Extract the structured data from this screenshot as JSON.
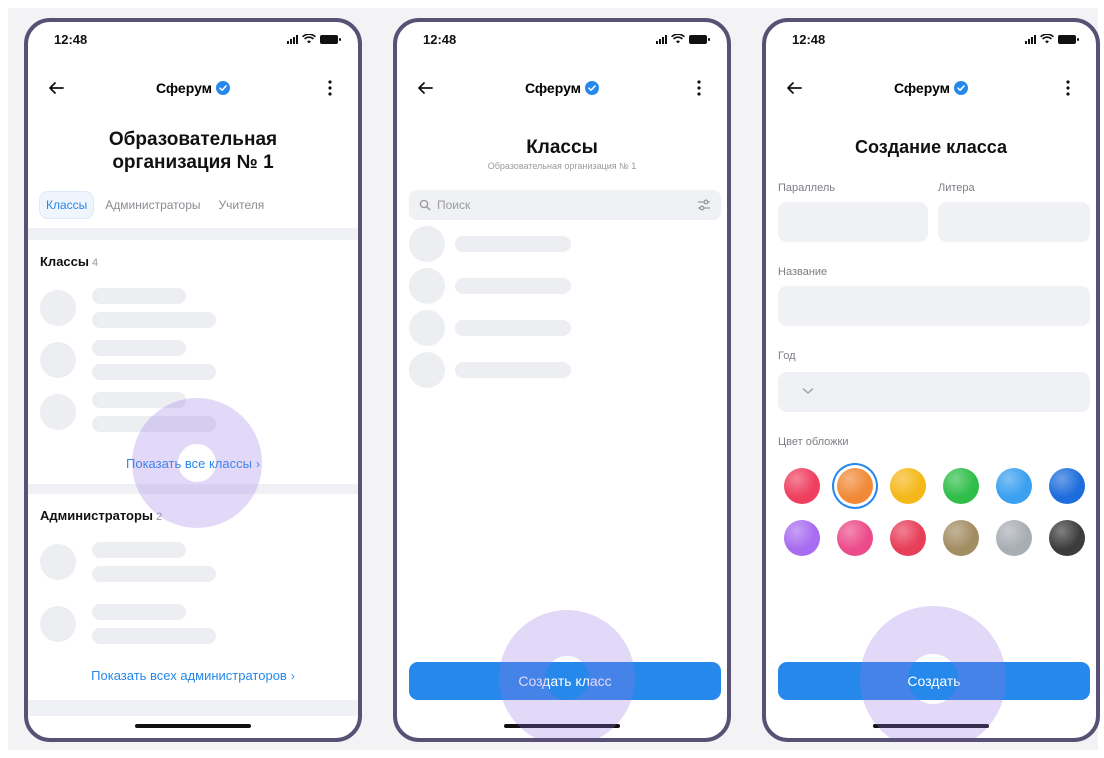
{
  "status_bar": {
    "time": "12:48"
  },
  "app": {
    "title": "Сферум",
    "accent": "#2688eb",
    "frame_color": "#595076"
  },
  "screens": [
    {
      "title": "Образовательная организация № 1",
      "title_lines": [
        "Образовательная",
        "организация № 1"
      ],
      "tabs": [
        {
          "label": "Классы",
          "active": true
        },
        {
          "label": "Администраторы",
          "active": false
        },
        {
          "label": "Учителя",
          "active": false
        }
      ],
      "sections": [
        {
          "title": "Классы",
          "count": "4",
          "link": "Показать все классы"
        },
        {
          "title": "Администраторы",
          "count": "2",
          "link": "Показать всех администраторов"
        }
      ]
    },
    {
      "title": "Классы",
      "subtitle": "Образовательная организация № 1",
      "search_placeholder": "Поиск",
      "primary_button": "Создать класс"
    },
    {
      "title": "Создание класса",
      "fields": {
        "parallel": "Параллель",
        "letter": "Литера",
        "name": "Название",
        "year": "Год"
      },
      "cover_color_label": "Цвет обложки",
      "cover_colors": [
        "#ef3f5f",
        "#f08a38",
        "#f5b819",
        "#2fbe4a",
        "#3aa0ef",
        "#1e6ddc",
        "#a86cf0",
        "#ec4c8b",
        "#e83e58",
        "#a38d63",
        "#a9aeb5",
        "#3c3c3c"
      ],
      "selected_color": "#f08a38",
      "primary_button": "Создать"
    }
  ]
}
